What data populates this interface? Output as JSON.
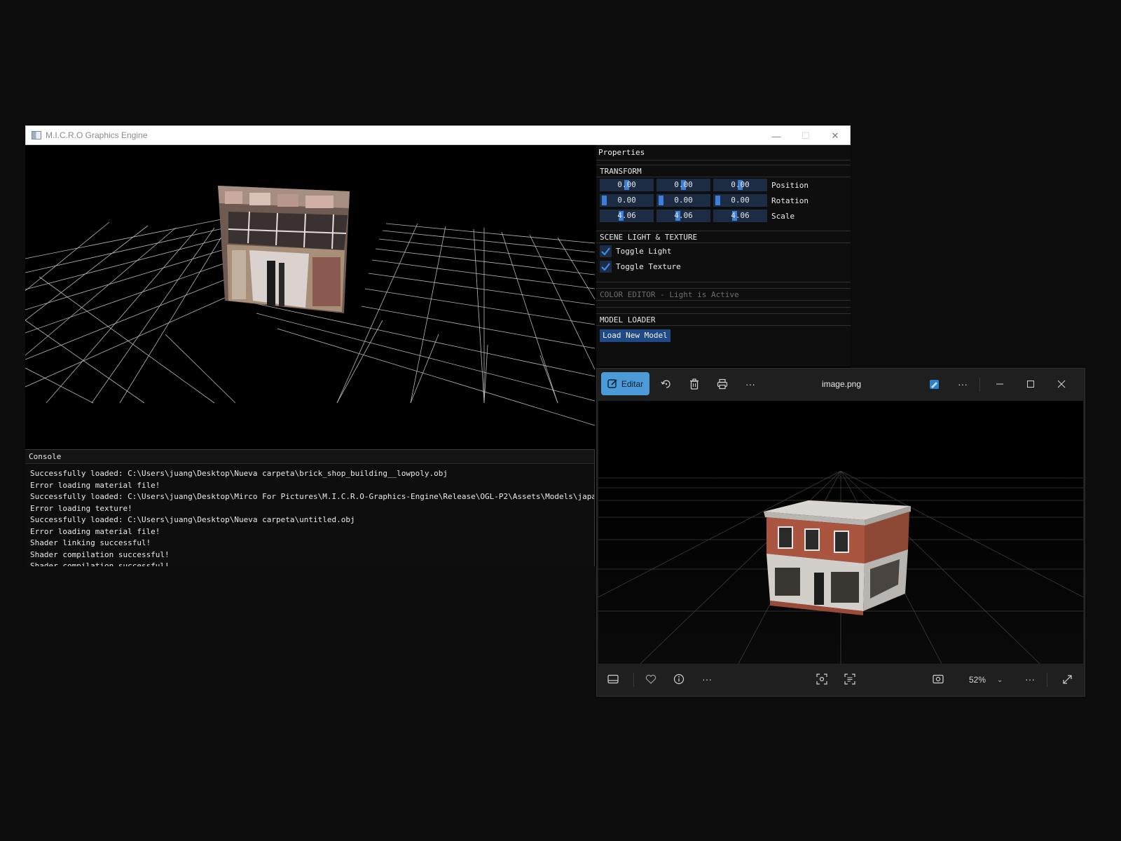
{
  "engine_window": {
    "title": "M.I.C.R.O Graphics Engine",
    "controls": {
      "minimize": "—",
      "maximize": "☐",
      "close": "✕"
    }
  },
  "properties": {
    "title": "Properties",
    "transform": {
      "heading": "TRANSFORM",
      "rows": [
        {
          "label": "Position",
          "values": [
            "0.00",
            "0.00",
            "0.00"
          ]
        },
        {
          "label": "Rotation",
          "values": [
            "0.00",
            "0.00",
            "0.00"
          ]
        },
        {
          "label": "Scale",
          "values": [
            "4.06",
            "4.06",
            "4.06"
          ]
        }
      ]
    },
    "scene": {
      "heading": "SCENE LIGHT & TEXTURE",
      "toggle_light": {
        "label": "Toggle Light",
        "checked": true
      },
      "toggle_texture": {
        "label": "Toggle Texture",
        "checked": true
      }
    },
    "color_editor": {
      "heading": "COLOR EDITOR - Light is Active"
    },
    "model_loader": {
      "heading": "MODEL LOADER",
      "button": "Load New Model"
    }
  },
  "console": {
    "title": "Console",
    "lines": [
      "Successfully loaded: C:\\Users\\juang\\Desktop\\Nueva carpeta\\brick_shop_building__lowpoly.obj",
      "Error loading material file!",
      "Successfully loaded: C:\\Users\\juang\\Desktop\\Mirco For Pictures\\M.I.C.R.O-Graphics-Engine\\Release\\OGL-P2\\Assets\\Models\\japan",
      "Error loading texture!",
      "Successfully loaded: C:\\Users\\juang\\Desktop\\Nueva carpeta\\untitled.obj",
      "Error loading material file!",
      "Shader linking successful!",
      "Shader compilation successful!",
      "Shader compilation successful!"
    ]
  },
  "photos_window": {
    "filename": "image.png",
    "edit_label": "Editar",
    "zoom": "52%",
    "icons": {
      "rotate": "rotate-icon",
      "delete": "trash-icon",
      "print": "print-icon",
      "more": "more-icon",
      "onedrive": "edit-photo-icon",
      "filmstrip": "filmstrip-icon",
      "favorite": "heart-icon",
      "info": "info-icon",
      "fit": "fit-screen-icon",
      "ocr": "scan-text-icon",
      "actual_size": "actual-size-icon",
      "fullscreen": "fullscreen-icon"
    }
  },
  "colors": {
    "desktop": "#0c0c0c",
    "accent": "#4b9bd8",
    "imgui_frame": "#1c2c44",
    "imgui_grab": "#3d7fd8"
  }
}
